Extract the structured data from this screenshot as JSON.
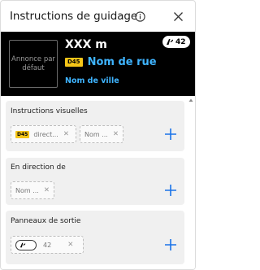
{
  "header": {
    "title": "Instructions de guidage"
  },
  "preview": {
    "default_sign": "Annonce par défaut",
    "distance": "XXX m",
    "road_number": "D45",
    "road_name": "Nom de rue",
    "city_name": "Nom de ville",
    "exit_number": "42"
  },
  "sections": {
    "visual": {
      "label": "Instructions visuelles",
      "chips": [
        {
          "shield": "D45",
          "text": "direct..."
        },
        {
          "shield": "",
          "text": "Nom ..."
        }
      ]
    },
    "direction": {
      "label": "En direction de",
      "chips": [
        {
          "text": "Nom ..."
        }
      ]
    },
    "exit": {
      "label": "Panneaux de sortie",
      "chips": [
        {
          "text": "42"
        }
      ]
    }
  },
  "colors": {
    "accent": "#1a73e8",
    "road_name": "#3fb4ff",
    "shield": "#f5c518"
  }
}
